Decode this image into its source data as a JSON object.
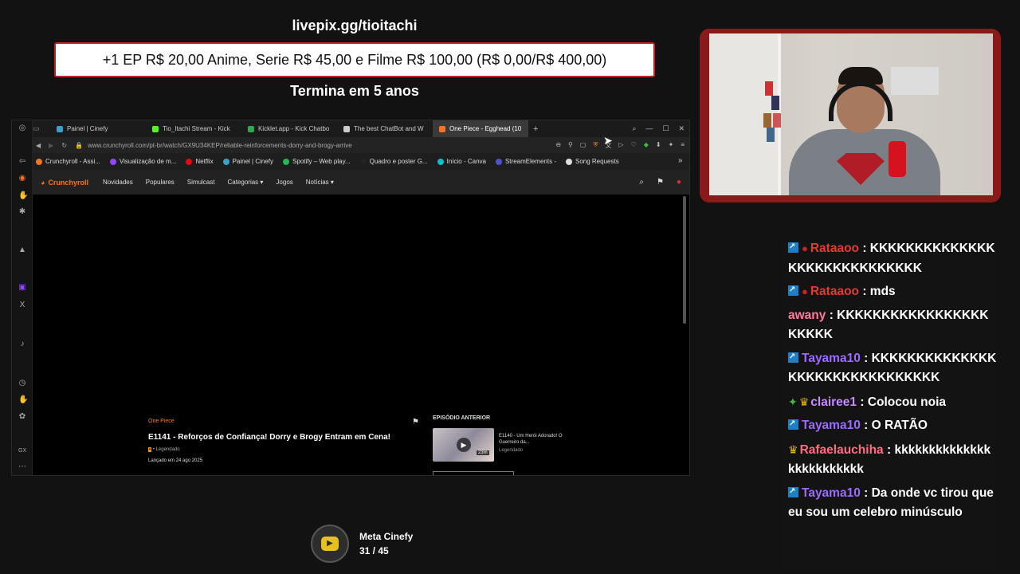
{
  "overlay": {
    "livepix": "livepix.gg/tioitachi",
    "goal": "+1 EP R$ 20,00 Anime, Serie R$ 45,00 e Filme R$ 100,00 (R$ 0,00/R$ 400,00)",
    "ends": "Termina em 5 anos"
  },
  "browser": {
    "tabs": [
      {
        "label": "Painel | Cinefy",
        "color": "#3aa1c9"
      },
      {
        "label": "Tio_Itachi Stream - Kick",
        "color": "#53fc18"
      },
      {
        "label": "Kicklet.app - Kick Chatbo",
        "color": "#2fa84f"
      },
      {
        "label": "The best ChatBot and W",
        "color": "#cccccc"
      },
      {
        "label": "One Piece - Egghead (10",
        "color": "#f47521"
      }
    ],
    "url": "www.crunchyroll.com/pt-br/watch/GX9U34KEP/reliable-reinforcements-dorry-and-brogy-arrive",
    "bookmarks": [
      {
        "label": "Crunchyroll - Assi...",
        "color": "#f47521"
      },
      {
        "label": "Visualização de m...",
        "color": "#9146ff"
      },
      {
        "label": "Netflix",
        "color": "#e50914"
      },
      {
        "label": "Painel | Cinefy",
        "color": "#3aa1c9"
      },
      {
        "label": "Spotify – Web play...",
        "color": "#1db954"
      },
      {
        "label": "Quadro e poster G...",
        "color": "#222222"
      },
      {
        "label": "Início - Canva",
        "color": "#00c4cc"
      },
      {
        "label": "StreamElements -",
        "color": "#4b53d4"
      },
      {
        "label": "Song Requests",
        "color": "#dddddd"
      }
    ]
  },
  "crunchyroll": {
    "logo": "Crunchyroll",
    "nav": [
      "Novidades",
      "Populares",
      "Simulcast",
      "Categorias",
      "Jogos",
      "Notícias"
    ],
    "episode": {
      "series": "One Piece",
      "title": "E1141 - Reforços de Confiança! Dorry e Brogy Entram em Cena!",
      "subtitle": "• Legendado",
      "date": "Lançado em 24 ago 2025"
    },
    "previous": {
      "heading": "EPISÓDIO ANTERIOR",
      "title": "E1140 - Um Herói Adorado! O Guerreiro da...",
      "subtitle": "Legendado",
      "duration": "23m"
    }
  },
  "chat": [
    {
      "badges": [
        "twitch",
        "dot"
      ],
      "user": "Rataaoo",
      "user_color": "#e53935",
      "text": "KKKKKKKKKKKKKKKKKKKKKKKKKKKKK"
    },
    {
      "badges": [
        "twitch",
        "dot"
      ],
      "user": "Rataaoo",
      "user_color": "#e53935",
      "text": "mds"
    },
    {
      "badges": [],
      "user": "awany",
      "user_color": "#ff7b9c",
      "text": "KKKKKKKKKKKKKKKKKKKKKK"
    },
    {
      "badges": [
        "twitch"
      ],
      "user": "Tayama10",
      "user_color": "#9b6bff",
      "text": "KKKKKKKKKKKKKKKKKKKKKKKKKKKKKKK"
    },
    {
      "badges": [
        "gem",
        "crown"
      ],
      "user": "clairee1",
      "user_color": "#c58bff",
      "text": "Colocou noia"
    },
    {
      "badges": [
        "twitch"
      ],
      "user": "Tayama10",
      "user_color": "#9b6bff",
      "text": "O RATÃO"
    },
    {
      "badges": [
        "crown"
      ],
      "user": "Rafaelauchiha",
      "user_color": "#ff6b81",
      "text": "kkkkkkkkkkkkkkkkkkkkkkkkk"
    },
    {
      "badges": [
        "twitch"
      ],
      "user": "Tayama10",
      "user_color": "#9b6bff",
      "text": "Da onde vc tirou que eu sou um celebro minúsculo"
    }
  ],
  "meta": {
    "label": "Meta Cinefy",
    "count": "31 / 45"
  },
  "colors": {
    "accent": "#f47521",
    "goal_border": "#c0202a",
    "cam_frame": "#8a1a1a"
  }
}
